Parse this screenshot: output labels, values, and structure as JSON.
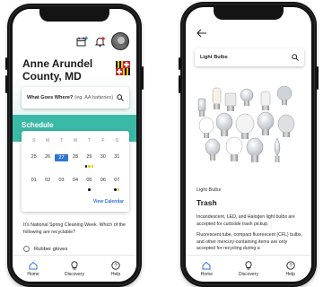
{
  "left_phone": {
    "title": "Anne Arundel County, MD",
    "search": {
      "label": "What Goes Where?",
      "placeholder": "(eg. AA batteries)"
    },
    "schedule": {
      "title": "Schedule",
      "days_of_week": [
        "S",
        "M",
        "T",
        "W",
        "T",
        "F",
        "S"
      ],
      "week1": [
        "25",
        "26",
        "27",
        "28",
        "29",
        "30",
        "31"
      ],
      "week2": [
        "01",
        "02",
        "03",
        "04",
        "05",
        "06",
        "07"
      ],
      "today": "27",
      "view_calendar": "View Calendar"
    },
    "quiz": {
      "question": "It's National Spring Cleaning Week. Which of the following are recyclable?",
      "option": "Rubber gloves"
    }
  },
  "right_phone": {
    "search_value": "Light Bulbs",
    "category": "Light Bulbs",
    "heading": "Trash",
    "body": [
      "Incandescent, LED, and Halogen light bulbs are accepted for curbside trash pickup.",
      "Fluorescent tube, compact fluorescent (CFL) bulbs, and other mercury-containing items are only accepted for recycling during a"
    ]
  },
  "tabbar": [
    "Home",
    "Discovery",
    "Help"
  ],
  "colors": {
    "teal": "#3bb9a7",
    "blue": "#2f76d2",
    "dot_black": "#111111",
    "dot_yellow": "#f0c419"
  },
  "icons": [
    "calendar-plus-icon",
    "bell-icon",
    "avatar",
    "maryland-flag-icon",
    "search-icon",
    "back-arrow-icon",
    "home-icon",
    "lightbulb-icon",
    "help-icon"
  ]
}
